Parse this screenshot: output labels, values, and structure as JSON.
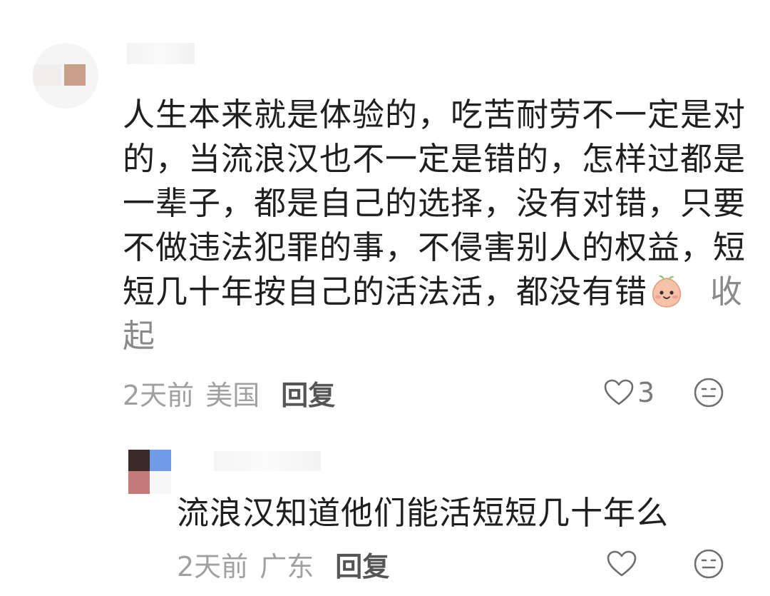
{
  "comment": {
    "username": "",
    "text": "人生本来就是体验的，吃苦耐劳不一定是对的，当流浪汉也不一定是错的，怎样过都是一辈子，都是自己的选择，没有对错，只要不做违法犯罪的事，不侵害别人的权益，短短几十年按自己的活法活，都没有错",
    "sticker": "peach-face-emoji",
    "collapse_label": "收起",
    "time": "2天前",
    "location": "美国",
    "reply_label": "回复",
    "like_count": "3",
    "icons": {
      "like": "heart-outline-icon",
      "dislike": "neutral-face-icon"
    }
  },
  "reply": {
    "username": "",
    "text": "流浪汉知道他们能活短短几十年么",
    "time": "2天前",
    "location": "广东",
    "reply_label": "回复",
    "like_count": "",
    "icons": {
      "like": "heart-outline-icon",
      "dislike": "neutral-face-icon"
    }
  },
  "colors": {
    "text": "#1f1f1f",
    "meta": "#a0a0a0",
    "reply_action": "#555555",
    "icon": "#6e6e6e",
    "sticker_fill": "#f6c2a8"
  }
}
